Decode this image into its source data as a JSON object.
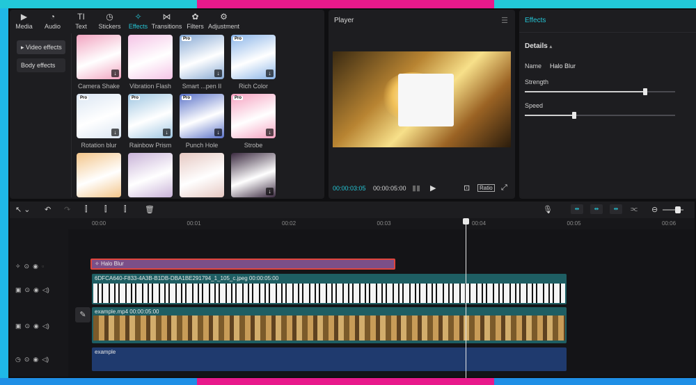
{
  "media_panel": {
    "tabs": [
      {
        "label": "Media",
        "icon": "media-icon",
        "glyph": "▶"
      },
      {
        "label": "Audio",
        "icon": "audio-icon",
        "glyph": "◔"
      },
      {
        "label": "Text",
        "icon": "text-icon",
        "glyph": "TI"
      },
      {
        "label": "Stickers",
        "icon": "stickers-icon",
        "glyph": "◷"
      },
      {
        "label": "Effects",
        "icon": "effects-icon",
        "glyph": "✧"
      },
      {
        "label": "Transitions",
        "icon": "transitions-icon",
        "glyph": "⋈"
      },
      {
        "label": "Filters",
        "icon": "filters-icon",
        "glyph": "✿"
      },
      {
        "label": "Adjustment",
        "icon": "adjustment-icon",
        "glyph": "⚙"
      }
    ],
    "active_tab": "Effects",
    "sidebar": [
      {
        "label": "▸ Video effects",
        "active": true
      },
      {
        "label": "Body effects",
        "active": false
      }
    ],
    "effects": [
      {
        "label": "Camera Shake",
        "pro": false,
        "download": true,
        "color": "#f2a4c0"
      },
      {
        "label": "Vibration Flash",
        "pro": false,
        "download": false,
        "color": "#f5c3e6"
      },
      {
        "label": "Smart ...pen II",
        "pro": true,
        "download": true,
        "color": "#87a9d4"
      },
      {
        "label": "Rich Color",
        "pro": true,
        "download": true,
        "color": "#8ab4e8"
      },
      {
        "label": "Rotation blur",
        "pro": true,
        "download": true,
        "color": "#dbe6f3"
      },
      {
        "label": "Rainbow Prism",
        "pro": true,
        "download": true,
        "color": "#9fc6e2"
      },
      {
        "label": "Punch Hole",
        "pro": true,
        "download": true,
        "color": "#5a72c8"
      },
      {
        "label": "Strobe",
        "pro": true,
        "download": true,
        "color": "#f6a1c0"
      },
      {
        "label": "",
        "pro": false,
        "download": false,
        "color": "#f3c58a"
      },
      {
        "label": "",
        "pro": false,
        "download": false,
        "color": "#c9b3d8"
      },
      {
        "label": "",
        "pro": false,
        "download": false,
        "color": "#e6c8c2"
      },
      {
        "label": "",
        "pro": false,
        "download": true,
        "color": "#3b2a40"
      }
    ]
  },
  "player": {
    "title": "Player",
    "current_time": "00:00:03:05",
    "total_time": "00:00:05:00",
    "ratio_label": "Ratio"
  },
  "effects_panel": {
    "title": "Effects",
    "details_label": "Details",
    "name_label": "Name",
    "name_value": "Halo Blur",
    "strength_label": "Strength",
    "strength_value": 0.8,
    "speed_label": "Speed",
    "speed_value": 0.33
  },
  "timeline": {
    "ruler": [
      "00:00",
      "00:01",
      "00:02",
      "00:03",
      "00:04",
      "00:05",
      "00:06"
    ],
    "effect_clip_label": "Halo Blur",
    "image_clip_label": "6DFCA640-F833-4A3B-B1DB-DBA1BE291794_1_105_c.jpeg   00:00:05:00",
    "video_clip_label": "example.mp4   00:00:05:00",
    "audio_clip_label": "example"
  },
  "colors": {
    "accent": "#25c6d6",
    "effect_clip": "#7b4f88",
    "selection": "#e0453d"
  }
}
